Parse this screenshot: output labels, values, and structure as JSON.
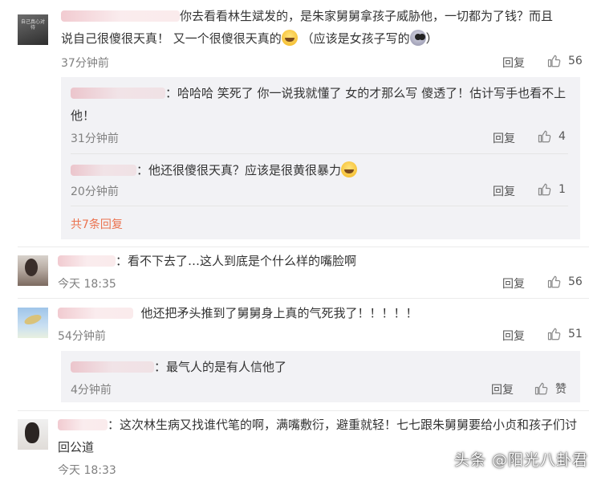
{
  "comments": [
    {
      "text_line1": "你去看看林生斌发的，是朱家舅舅拿孩子威胁他，一切都为了钱？而且",
      "text_line2_a": "说自己很傻很天真！  又一个很傻很天真的",
      "text_line2_b": "（应该是女孩子写的",
      "text_line2_c": "）",
      "avatar_text": "自己真心对待",
      "time": "37分钟前",
      "reply_label": "回复",
      "likes": "56",
      "replies": [
        {
          "text_line1": "：哈哈哈 笑死了 你一说我就懂了 女的才那么写 傻透了！估计写手也看不上",
          "text_line2": "他！",
          "time": "31分钟前",
          "reply_label": "回复",
          "likes": "4"
        },
        {
          "text": "：他还很傻很天真？应该是很黄很暴力",
          "time": "20分钟前",
          "reply_label": "回复",
          "likes": "1"
        }
      ],
      "more_replies": "共7条回复"
    },
    {
      "text": "：看不下去了…这人到底是个什么样的嘴脸啊",
      "time": "今天 18:35",
      "reply_label": "回复",
      "likes": "56"
    },
    {
      "text": "他还把矛头推到了舅舅身上真的气死我了！！！！！",
      "time": "54分钟前",
      "reply_label": "回复",
      "likes": "51",
      "replies": [
        {
          "text": "：最气人的是有人信他了",
          "time": "4分钟前",
          "reply_label": "回复",
          "likes": "赞"
        }
      ]
    },
    {
      "text_line1": "：这次林生病又找谁代笔的啊，满嘴敷衍，避重就轻！七七跟朱舅舅要给小贞和孩子们讨",
      "text_line2": "回公道",
      "time": "今天 18:33"
    }
  ],
  "watermark": "头条 @阳光八卦君",
  "colors": {
    "accent": "#eb7350",
    "reply_bg": "#f2f2f5",
    "meta": "#808080"
  },
  "icons": {
    "like": "thumbs-up-icon",
    "laugh": "laughing-emoji-icon",
    "cry": "crying-emoji-icon"
  }
}
